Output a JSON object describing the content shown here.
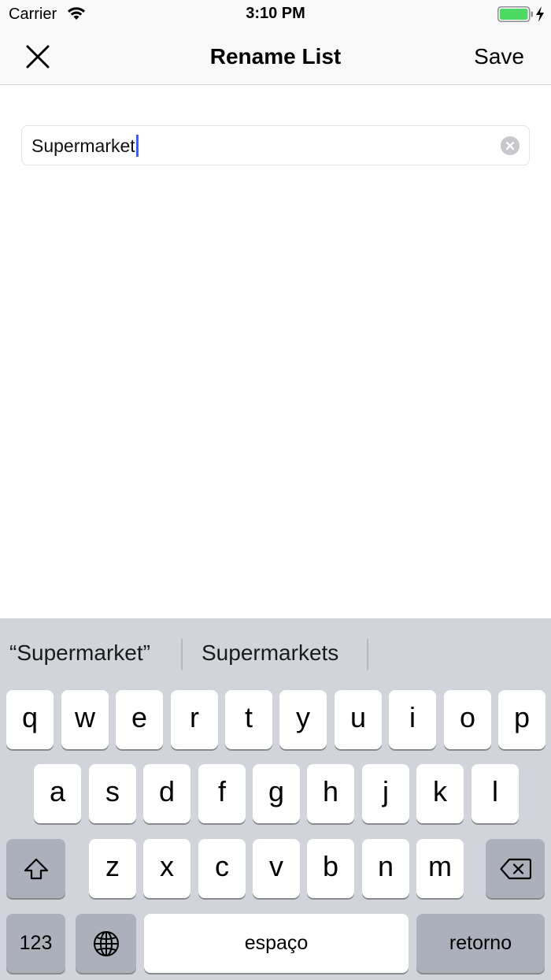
{
  "status_bar": {
    "carrier": "Carrier",
    "time": "3:10 PM",
    "battery_color": "#4cd964"
  },
  "nav": {
    "title": "Rename List",
    "save_label": "Save",
    "close_icon": "close-icon"
  },
  "text_field": {
    "value": "Supermarket",
    "caret_color": "#3b5bff",
    "clear_icon": "clear-icon"
  },
  "keyboard": {
    "suggestions": [
      "“Supermarket”",
      "Supermarkets"
    ],
    "row1": [
      "q",
      "w",
      "e",
      "r",
      "t",
      "y",
      "u",
      "i",
      "o",
      "p"
    ],
    "row2": [
      "a",
      "s",
      "d",
      "f",
      "g",
      "h",
      "j",
      "k",
      "l"
    ],
    "row3": [
      "z",
      "x",
      "c",
      "v",
      "b",
      "n",
      "m"
    ],
    "numbers_label": "123",
    "space_label": "espaço",
    "return_label": "retorno",
    "shift_icon": "shift-icon",
    "delete_icon": "delete-icon",
    "globe_icon": "globe-icon"
  }
}
